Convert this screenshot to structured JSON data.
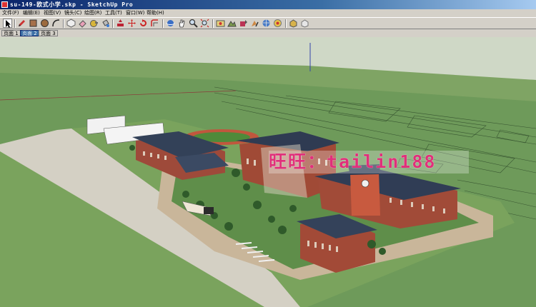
{
  "window": {
    "title": "su-149-欧式小学.skp - SketchUp Pro",
    "app_icon": "sketchup-icon"
  },
  "menu": {
    "items": [
      "文件(F)",
      "编辑(E)",
      "视图(V)",
      "镜头(C)",
      "绘图(R)",
      "工具(T)",
      "窗口(W)",
      "帮助(H)"
    ]
  },
  "toolbar": {
    "tools": [
      "select-icon",
      "pencil-icon",
      "rectangle-icon",
      "circle-icon",
      "arc-icon",
      "make-component-icon",
      "eraser-icon",
      "tape-measure-icon",
      "paint-bucket-icon",
      "push-pull-icon",
      "move-icon",
      "rotate-icon",
      "offset-icon",
      "orbit-icon",
      "pan-icon",
      "zoom-icon",
      "zoom-extents-icon",
      "add-location-icon",
      "toggle-terrain-icon",
      "get-models-icon",
      "share-model-icon",
      "share-component-icon",
      "photo-textures-icon",
      "component-icon"
    ]
  },
  "scenes": {
    "tabs": [
      "页面 1",
      "页面 2",
      "页面 3"
    ],
    "active_index": 1
  },
  "viewport": {
    "watermark": "旺旺：tailin188",
    "ground_color": "#7fa464",
    "sky_color": "#cfd8c6"
  }
}
